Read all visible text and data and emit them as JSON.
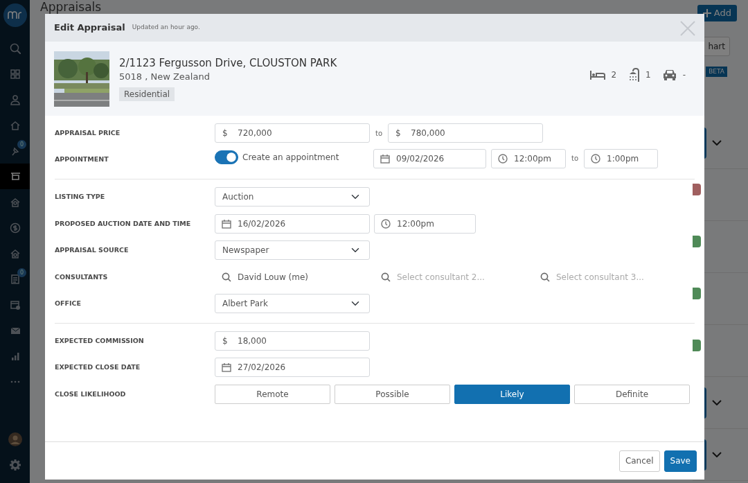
{
  "sidebar": {
    "items": [
      {
        "selected": false
      },
      {
        "selected": false
      },
      {
        "selected": false
      },
      {
        "selected": false
      },
      {
        "selected": false,
        "badge": "0"
      },
      {
        "selected": true
      },
      {
        "selected": false
      },
      {
        "selected": false
      },
      {
        "selected": false
      },
      {
        "selected": false,
        "badge": "0"
      },
      {
        "selected": false
      },
      {
        "selected": false
      },
      {
        "selected": false
      },
      {
        "selected": false
      }
    ]
  },
  "page": {
    "title": "Appraisals",
    "add_button": "Add",
    "chart_button": "hart",
    "beta_badge": "BETA",
    "rows": [
      {
        "kind": "dropdown"
      },
      {
        "kind": "tag",
        "color": "#a05f5f"
      },
      {
        "kind": "tag",
        "color": "#4f8a57"
      },
      {
        "kind": "tag",
        "color": "#4f8a57"
      },
      {
        "kind": "tag",
        "color": "#4f8a57"
      },
      {
        "kind": "dropdown"
      },
      {
        "kind": "dropdown"
      }
    ]
  },
  "modal": {
    "title": "Edit Appraisal",
    "subtitle": "Updated an hour ago.",
    "property": {
      "address": "2/1123 Fergusson Drive, CLOUSTON PARK",
      "locality": "5018 , New Zealand",
      "tag": "Residential",
      "bedrooms": "2",
      "bathrooms": "1",
      "car_parks": "-"
    },
    "sections": [
      [
        {
          "kind": "range",
          "label": "APPRAISAL PRICE",
          "prefix": "$",
          "from": "720,000",
          "joiner": "to",
          "to_value": "780,000"
        },
        {
          "kind": "appointment",
          "label": "APPOINTMENT",
          "toggle": {
            "on": true,
            "label": "Create an appointment"
          },
          "date": "09/02/2026",
          "start": "12:00pm",
          "joiner": "to",
          "end": "1:00pm"
        }
      ],
      [
        {
          "kind": "select",
          "label": "LISTING TYPE",
          "value": "Auction"
        },
        {
          "kind": "datetime",
          "label": "PROPOSED AUCTION DATE AND TIME",
          "date": "16/02/2026",
          "time": "12:00pm"
        },
        {
          "kind": "select",
          "label": "APPRAISAL SOURCE",
          "value": "Newspaper"
        },
        {
          "kind": "consultants",
          "label": "CONSULTANTS",
          "fields": [
            {
              "value": "David Louw (me)"
            },
            {
              "placeholder": "Select consultant 2..."
            },
            {
              "placeholder": "Select consultant 3..."
            }
          ]
        },
        {
          "kind": "select",
          "label": "OFFICE",
          "value": "Albert Park"
        }
      ],
      [
        {
          "kind": "money",
          "label": "EXPECTED COMMISSION",
          "prefix": "$",
          "value": "18,000"
        },
        {
          "kind": "date",
          "label": "EXPECTED CLOSE DATE",
          "value": "27/02/2026"
        },
        {
          "kind": "segmented",
          "label": "CLOSE LIKELIHOOD",
          "options": [
            {
              "label": "Remote",
              "selected": false
            },
            {
              "label": "Possible",
              "selected": false
            },
            {
              "label": "Likely",
              "selected": true
            },
            {
              "label": "Definite",
              "selected": false
            }
          ]
        }
      ]
    ],
    "buttons": [
      {
        "label": "Cancel",
        "kind": "secondary"
      },
      {
        "label": "Save",
        "kind": "primary"
      }
    ]
  }
}
